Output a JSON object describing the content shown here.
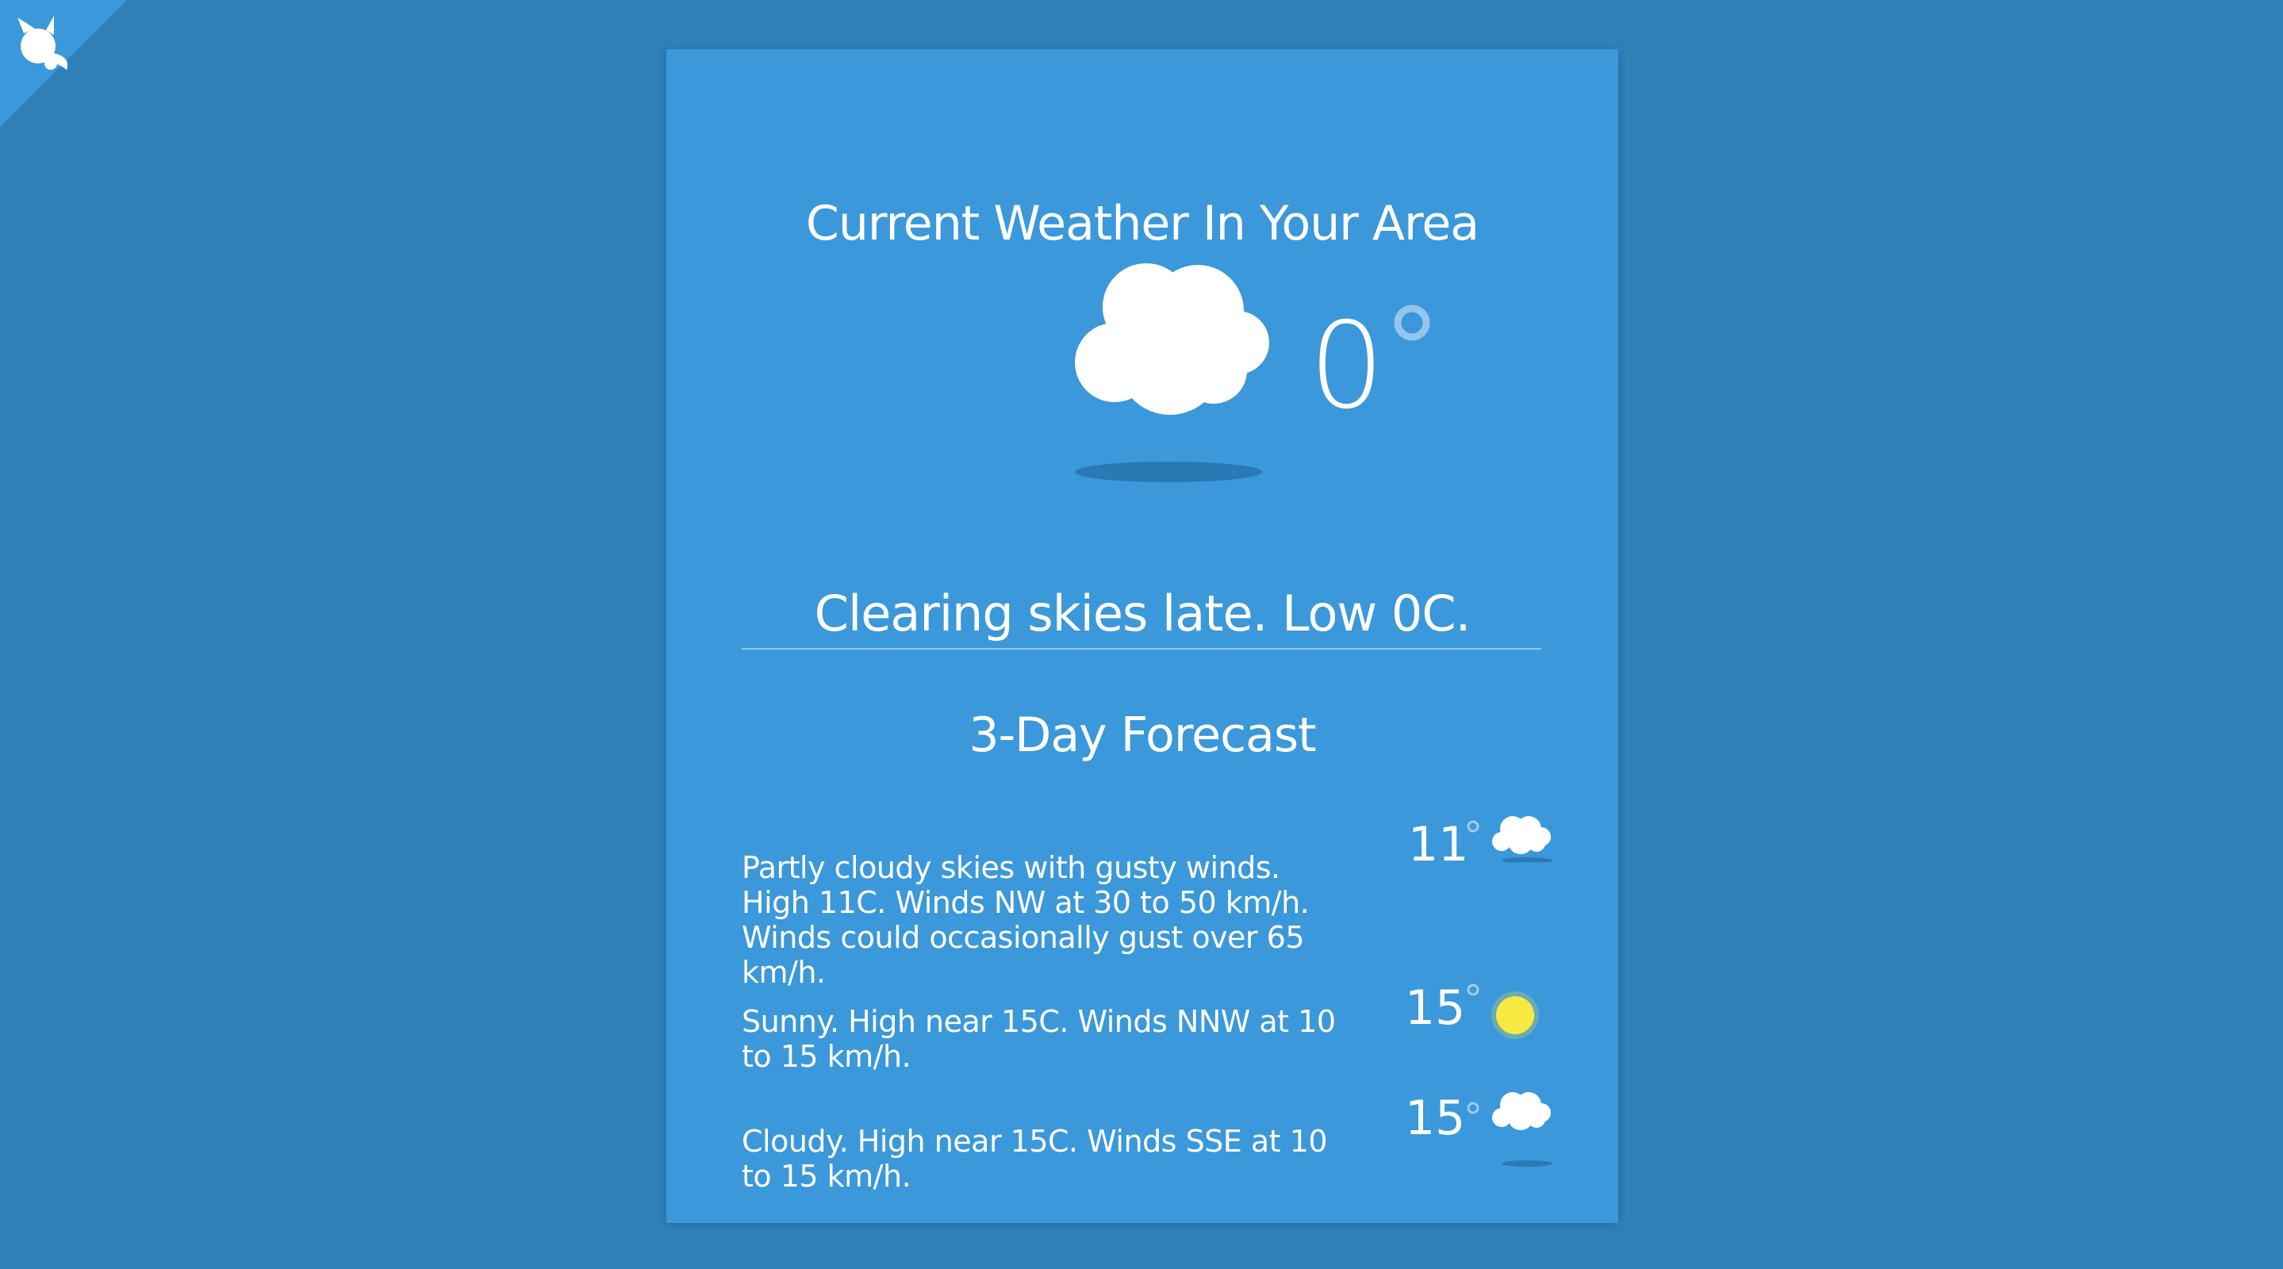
{
  "header": {
    "title": "Current Weather In Your Area"
  },
  "current": {
    "temperature": "0",
    "condition_icon": "cloud-icon",
    "summary": "Clearing skies late. Low 0C."
  },
  "forecast": {
    "title": "3-Day Forecast",
    "days": [
      {
        "text": "Partly cloudy skies with gusty winds. High 11C. Winds NW at 30 to 50 km/h. Winds could occasionally gust over 65 km/h.",
        "temperature": "11",
        "icon": "cloud-icon"
      },
      {
        "text": "Sunny. High near 15C. Winds NNW at 10 to 15 km/h.",
        "temperature": "15",
        "icon": "sun-icon"
      },
      {
        "text": "Cloudy. High near 15C. Winds SSE at 10 to 15 km/h.",
        "temperature": "15",
        "icon": "cloud-icon"
      }
    ]
  },
  "colors": {
    "background": "#2f80b9",
    "card": "#3b98da",
    "sun": "#f7e93f",
    "text": "#ffffff"
  }
}
